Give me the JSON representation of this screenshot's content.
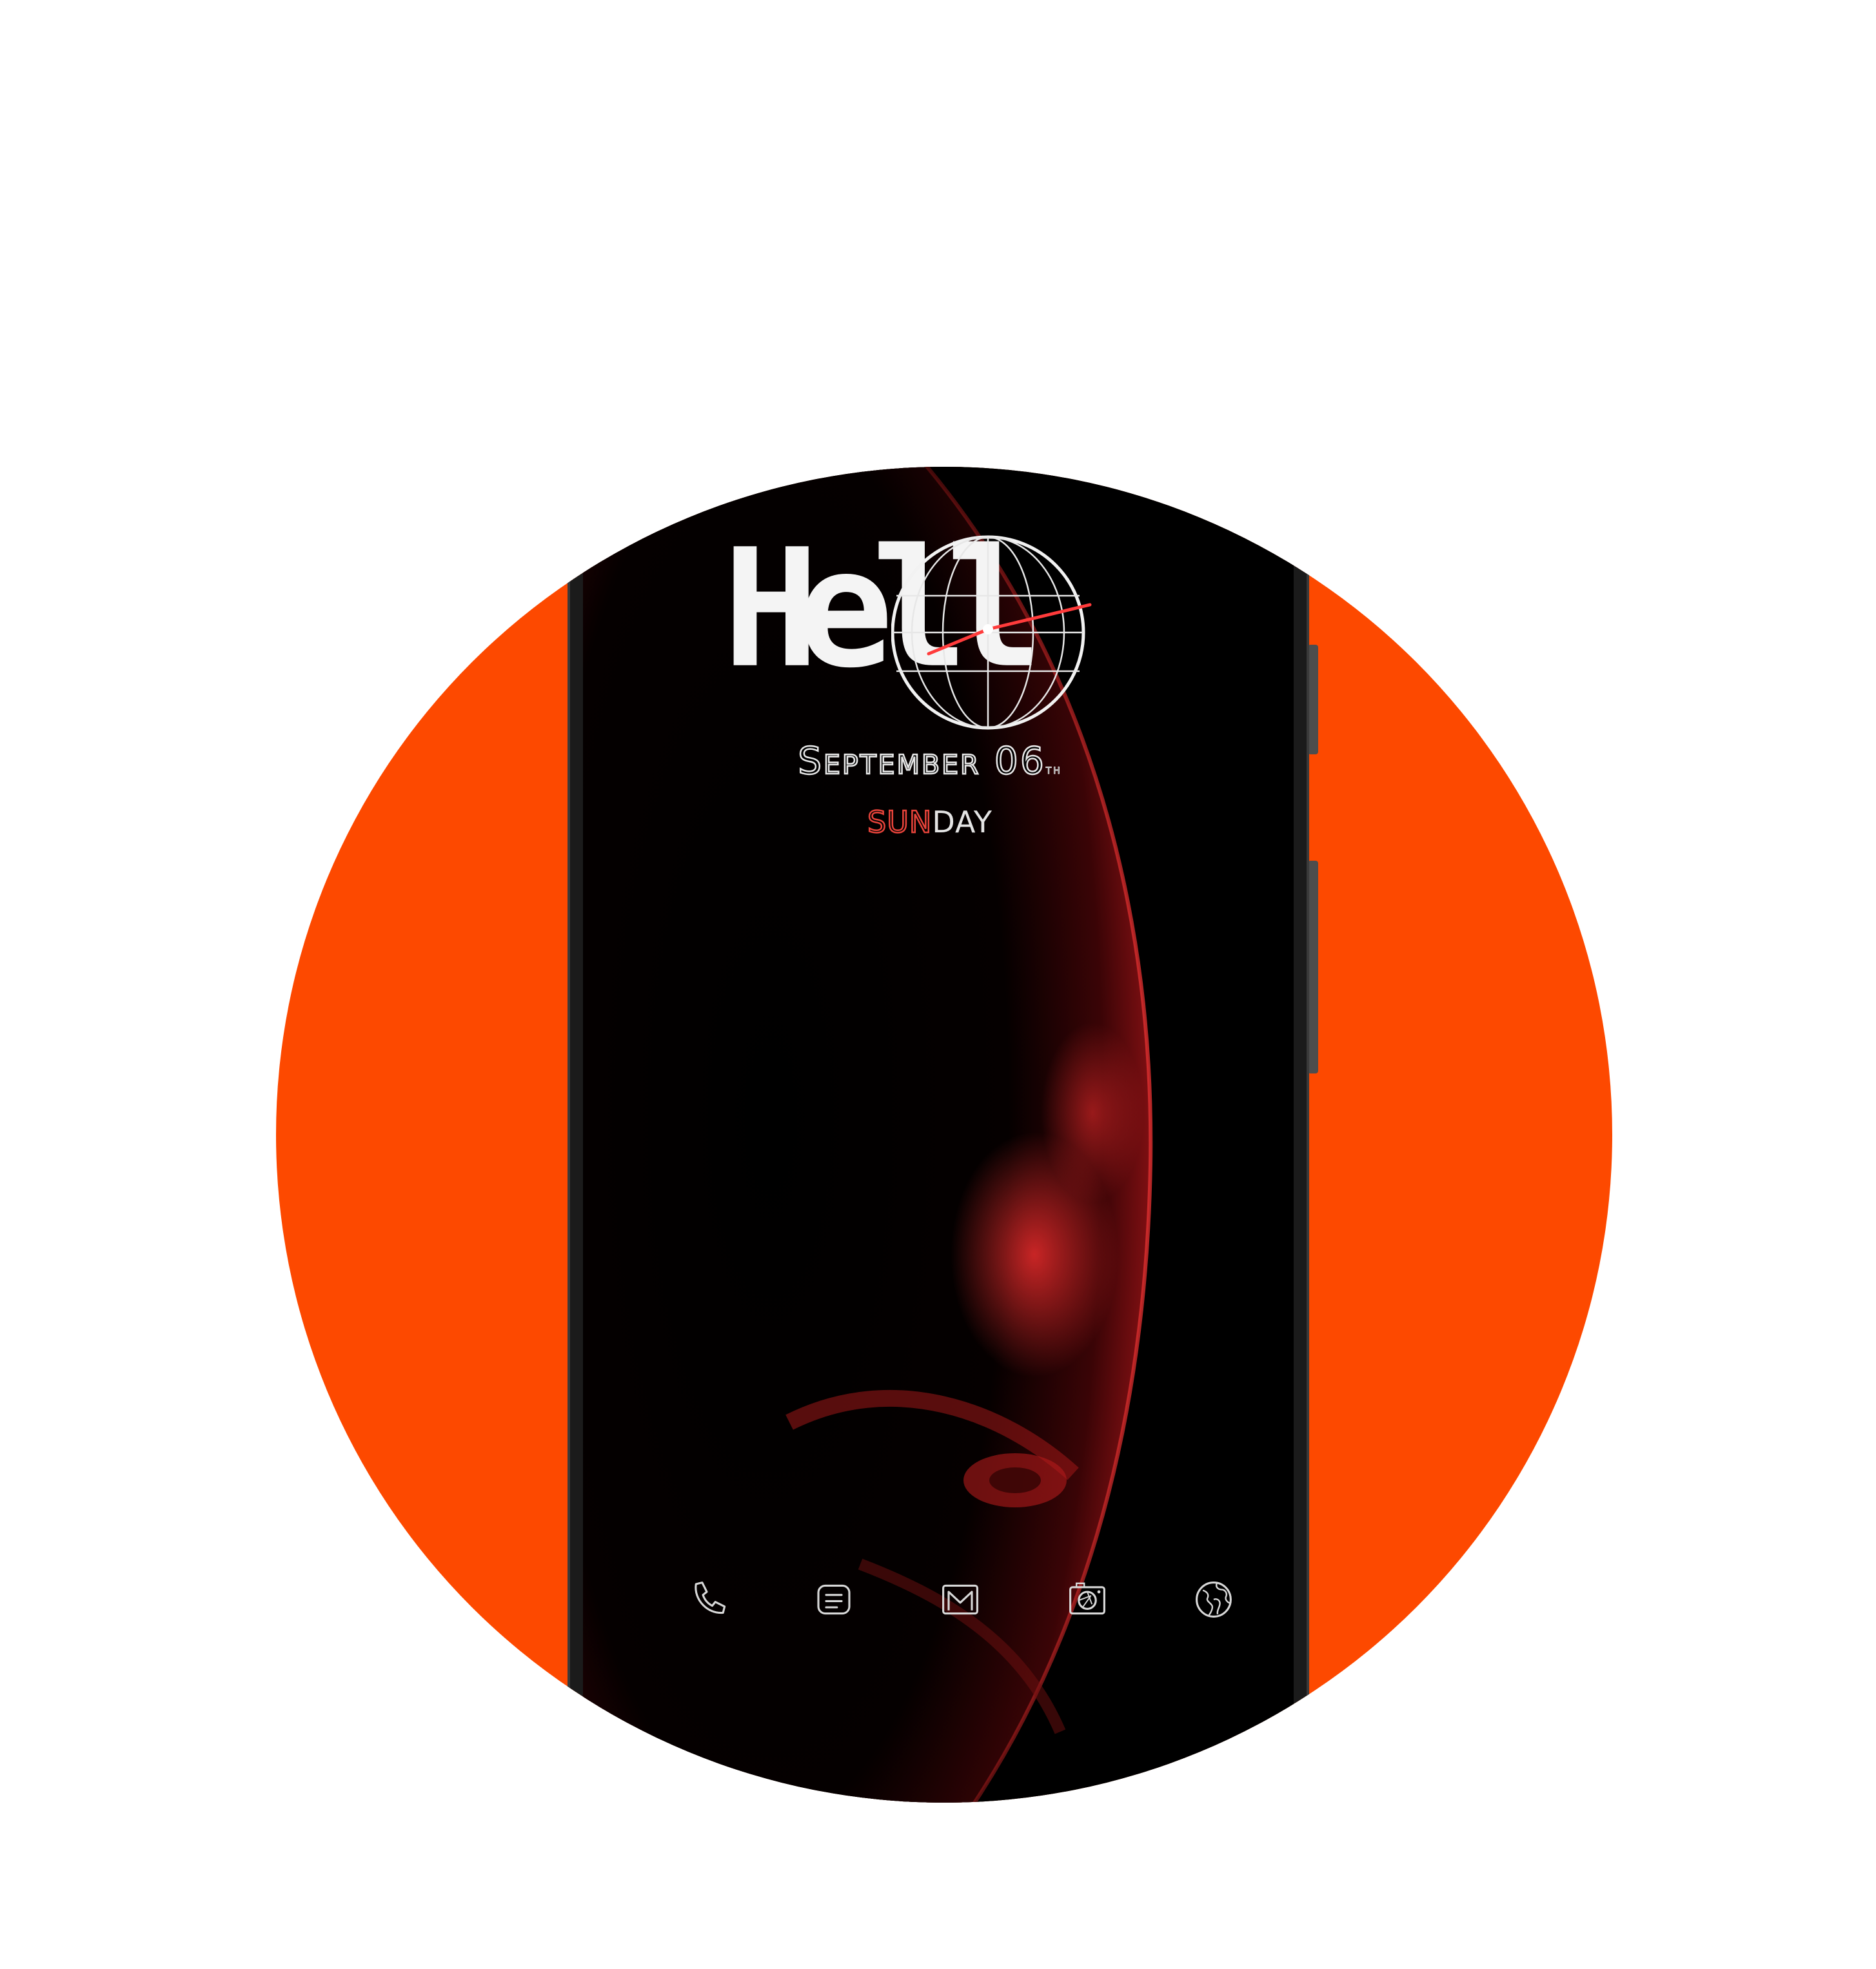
{
  "colors": {
    "accent_orange": "#fd4900",
    "screen_bg": "#000000",
    "planet_red": "#d4282a",
    "clock_hand": "#ff3b3b",
    "text_white": "#f4f4f4"
  },
  "lockscreen": {
    "greeting": "Hell",
    "date": "September 06",
    "date_suffix": "th",
    "day_highlight": "SUN",
    "day_rest": "DAY"
  },
  "dock": {
    "icons": [
      "phone-icon",
      "messages-icon",
      "gmail-icon",
      "camera-icon",
      "browser-globe-icon"
    ]
  }
}
